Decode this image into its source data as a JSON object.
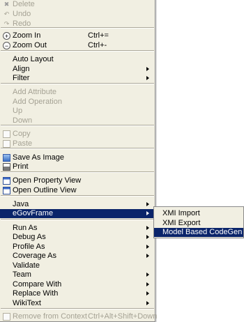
{
  "menu": {
    "items": [
      {
        "label": "Delete",
        "icon": "delete-icon",
        "disabled": true
      },
      {
        "label": "Undo",
        "icon": "undo-icon",
        "disabled": true
      },
      {
        "label": "Redo",
        "icon": "redo-icon",
        "disabled": true
      },
      {
        "label": "Zoom In",
        "accel": "Ctrl+=",
        "icon": "zoom-in-icon"
      },
      {
        "label": "Zoom Out",
        "accel": "Ctrl+-",
        "icon": "zoom-out-icon"
      },
      {
        "label": "Auto Layout"
      },
      {
        "label": "Align"
      },
      {
        "label": "Filter"
      },
      {
        "label": "Add Attribute",
        "disabled": true
      },
      {
        "label": "Add Operation",
        "disabled": true
      },
      {
        "label": "Up",
        "disabled": true
      },
      {
        "label": "Down",
        "disabled": true
      },
      {
        "label": "Copy",
        "icon": "copy-icon",
        "disabled": true
      },
      {
        "label": "Paste",
        "icon": "paste-icon",
        "disabled": true
      },
      {
        "label": "Save As Image",
        "icon": "save-image-icon"
      },
      {
        "label": "Print",
        "icon": "print-icon"
      },
      {
        "label": "Open Property View",
        "icon": "property-view-icon"
      },
      {
        "label": "Open Outline View",
        "icon": "outline-view-icon"
      },
      {
        "label": "Java"
      },
      {
        "label": "eGovFrame"
      },
      {
        "label": "Run As"
      },
      {
        "label": "Debug As"
      },
      {
        "label": "Profile As"
      },
      {
        "label": "Coverage As"
      },
      {
        "label": "Validate"
      },
      {
        "label": "Team"
      },
      {
        "label": "Compare With"
      },
      {
        "label": "Replace With"
      },
      {
        "label": "WikiText"
      },
      {
        "label": "Remove from Context",
        "accel": "Ctrl+Alt+Shift+Down",
        "icon": "remove-context-icon",
        "disabled": true
      }
    ]
  },
  "submenu": {
    "items": [
      {
        "label": "XMI Import"
      },
      {
        "label": "XMI Export"
      },
      {
        "label": "Model Based CodeGen"
      }
    ]
  },
  "colors": {
    "menu_bg": "#f1efe2",
    "highlight": "#0a246a",
    "disabled_text": "#a5a294"
  }
}
